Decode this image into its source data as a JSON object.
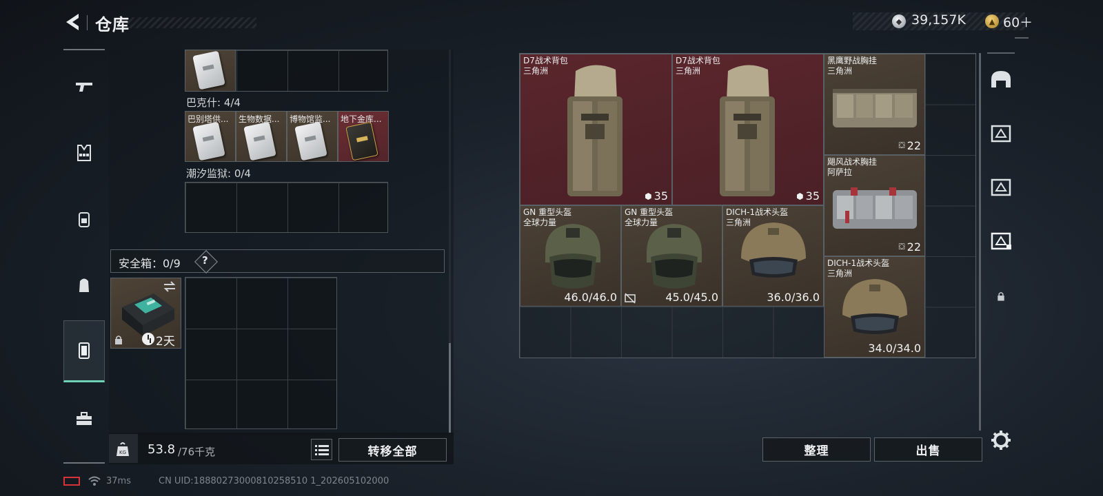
{
  "header": {
    "title": "仓库",
    "currency": {
      "money": "39,157K",
      "tickets": "60＋"
    }
  },
  "left_nav": {
    "items": [
      "gun-icon",
      "vest-icon",
      "backpack-icon",
      "pouch-icon",
      "safe-box-icon",
      "toolbox-icon"
    ],
    "active_index": 4
  },
  "stash": {
    "top_cards": [
      {
        "label": "",
        "style": "brown"
      }
    ],
    "sections": [
      {
        "label": "巴克什: 4/4",
        "cards": [
          {
            "label": "巴别塔供...",
            "style": "brown"
          },
          {
            "label": "生物数据...",
            "style": "brown"
          },
          {
            "label": "博物馆监...",
            "style": "brown"
          },
          {
            "label": "地下金库...",
            "style": "red"
          }
        ]
      },
      {
        "label": "潮汐监狱: 0/4",
        "cards": []
      }
    ],
    "safe_box": {
      "label": "安全箱：0/9",
      "help": "?",
      "days": "2天"
    }
  },
  "weight": {
    "current": "53.8",
    "max": "/76千克"
  },
  "buttons": {
    "transfer_all": "转移全部",
    "sort": "整理",
    "sell": "出售"
  },
  "container_items": [
    {
      "name": "D7战术背包",
      "sub": "三角洲",
      "stat": "35",
      "stat_icon": "backpack-capacity-icon",
      "style": "red",
      "type": "backpack"
    },
    {
      "name": "D7战术背包",
      "sub": "三角洲",
      "stat": "35",
      "stat_icon": "backpack-capacity-icon",
      "style": "red",
      "type": "backpack"
    },
    {
      "name": "黑鹰野战胸挂",
      "sub": "三角洲",
      "stat": "22",
      "stat_icon": "vest-capacity-icon",
      "style": "brown",
      "type": "vest-tan"
    },
    {
      "name": "飓风战术胸挂",
      "sub": "阿萨拉",
      "stat": "22",
      "stat_icon": "vest-capacity-icon",
      "style": "brown",
      "type": "vest-grey"
    },
    {
      "name": "GN 重型头盔",
      "sub": "全球力量",
      "stat": "46.0/46.0",
      "stat_icon": "",
      "style": "brown",
      "type": "helmet-green"
    },
    {
      "name": "GN 重型头盔",
      "sub": "全球力量",
      "stat": "45.0/45.0",
      "stat_icon": "no-repair-icon",
      "style": "brown",
      "type": "helmet-green"
    },
    {
      "name": "DICH-1战术头盔",
      "sub": "三角洲",
      "stat": "36.0/36.0",
      "stat_icon": "",
      "style": "brown",
      "type": "helmet-tan"
    },
    {
      "name": "DICH-1战术头盔",
      "sub": "三角洲",
      "stat": "34.0/34.0",
      "stat_icon": "",
      "style": "brown",
      "type": "helmet-tan"
    }
  ],
  "right_nav": [
    "helmet-slot-icon",
    "armor-slot-icon",
    "armor-slot-2-icon",
    "armor-slot-3-icon",
    "lock-icon"
  ],
  "status": {
    "ping": "37ms",
    "uid": "CN UID:18880273000810258510 1_202605102000"
  },
  "colors": {
    "accent": "#6fd1b6",
    "item_red": "#5a262c",
    "item_brown": "#4b4136"
  }
}
